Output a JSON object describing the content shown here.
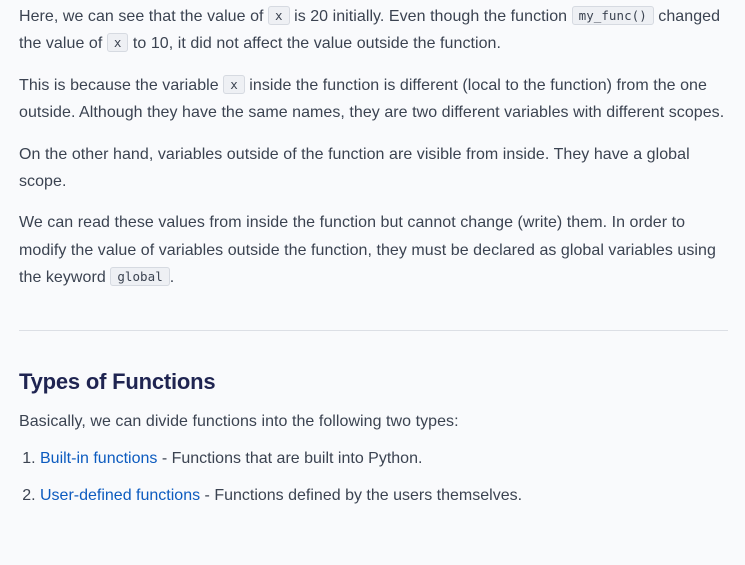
{
  "paragraph1": {
    "t1": "Here, we can see that the value of ",
    "code1": "x",
    "t2": " is 20 initially. Even though the function ",
    "code2": "my_func()",
    "t3": " changed the value of ",
    "code3": "x",
    "t4": " to 10, it did not affect the value outside the function."
  },
  "paragraph2": {
    "t1": "This is because the variable ",
    "code1": "x",
    "t2": " inside the function is different (local to the function) from the one outside. Although they have the same names, they are two different variables with different scopes."
  },
  "paragraph3": {
    "text": "On the other hand, variables outside of the function are visible from inside. They have a global scope."
  },
  "paragraph4": {
    "t1": "We can read these values from inside the function but cannot change (write) them. In order to modify the value of variables outside the function, they must be declared as global variables using the keyword ",
    "code1": "global",
    "t2": "."
  },
  "section": {
    "heading": "Types of Functions",
    "intro": "Basically, we can divide functions into the following two types:",
    "items": [
      {
        "link": "Built-in functions",
        "desc": " - Functions that are built into Python."
      },
      {
        "link": "User-defined functions",
        "desc": " - Functions defined by the users themselves."
      }
    ]
  },
  "colors": {
    "link": "#0c5bbf",
    "heading": "#1f2451",
    "text": "#3b4351",
    "background": "#f9fafc"
  }
}
